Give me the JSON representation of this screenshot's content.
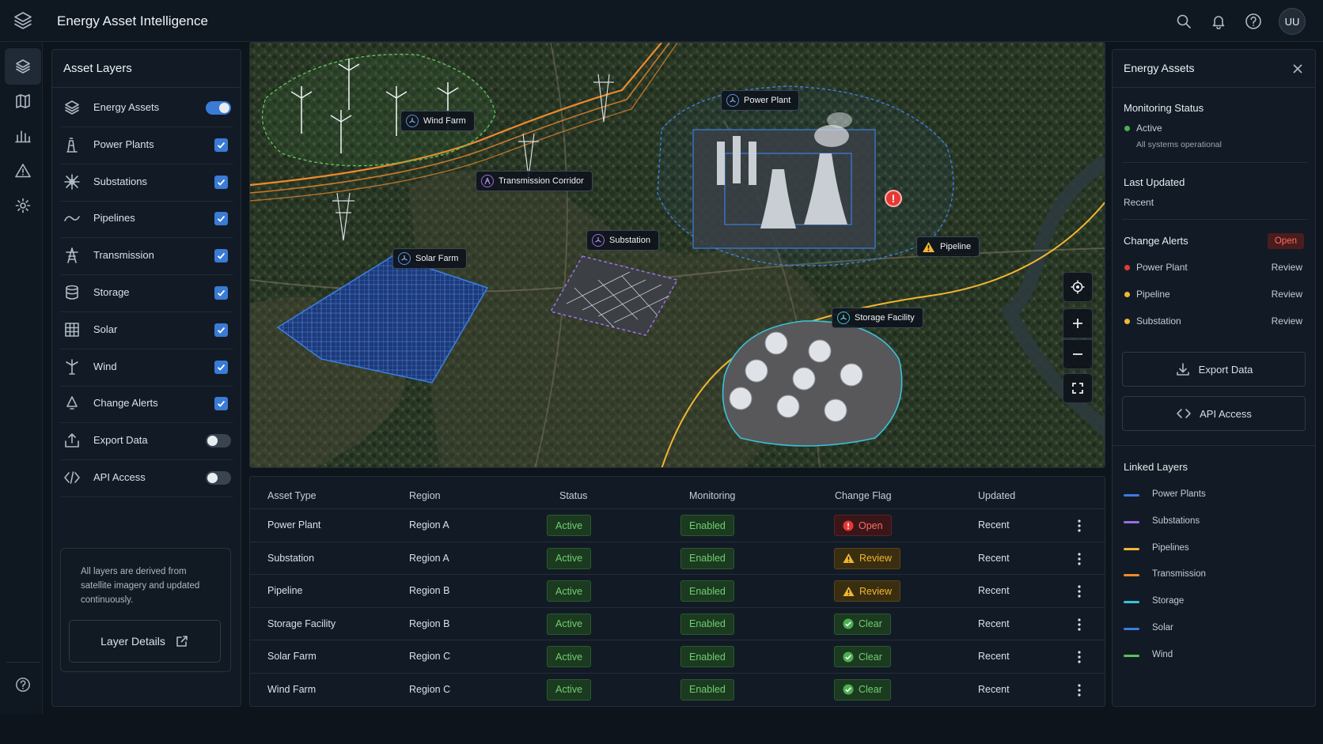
{
  "app": {
    "title": "Energy Asset Intelligence",
    "user_initials": "UU"
  },
  "layers_panel": {
    "title": "Asset Layers",
    "items": [
      {
        "label": "Energy Assets",
        "control": "toggle",
        "on": true,
        "icon": "layers-icon"
      },
      {
        "label": "Power Plants",
        "control": "checkbox",
        "on": true,
        "icon": "power-plant-icon"
      },
      {
        "label": "Substations",
        "control": "checkbox",
        "on": true,
        "icon": "substation-icon"
      },
      {
        "label": "Pipelines",
        "control": "checkbox",
        "on": true,
        "icon": "pipeline-icon"
      },
      {
        "label": "Transmission",
        "control": "checkbox",
        "on": true,
        "icon": "transmission-tower-icon"
      },
      {
        "label": "Storage",
        "control": "checkbox",
        "on": true,
        "icon": "storage-icon"
      },
      {
        "label": "Solar",
        "control": "checkbox",
        "on": true,
        "icon": "solar-panel-icon"
      },
      {
        "label": "Wind",
        "control": "checkbox",
        "on": true,
        "icon": "wind-turbine-icon"
      },
      {
        "label": "Change Alerts",
        "control": "checkbox",
        "on": true,
        "icon": "alert-bell-icon"
      },
      {
        "label": "Export Data",
        "control": "toggle",
        "on": false,
        "icon": "export-icon"
      },
      {
        "label": "API Access",
        "control": "toggle",
        "on": false,
        "icon": "code-icon"
      }
    ],
    "info_text": "All layers are derived from satellite imagery and updated continuously.",
    "details_button": "Layer Details"
  },
  "map": {
    "labels": {
      "wind_farm": "Wind Farm",
      "transmission": "Transmission Corridor",
      "power_plant": "Power Plant",
      "substation": "Substation",
      "solar_farm": "Solar Farm",
      "pipeline": "Pipeline",
      "storage": "Storage Facility"
    }
  },
  "table": {
    "headers": [
      "Asset Type",
      "Region",
      "Status",
      "Monitoring",
      "Change Flag",
      "Updated"
    ],
    "rows": [
      {
        "asset": "Power Plant",
        "region": "Region A",
        "status": "Active",
        "monitoring": "Enabled",
        "flag": "Open",
        "flag_kind": "red",
        "updated": "Recent"
      },
      {
        "asset": "Substation",
        "region": "Region A",
        "status": "Active",
        "monitoring": "Enabled",
        "flag": "Review",
        "flag_kind": "amber",
        "updated": "Recent"
      },
      {
        "asset": "Pipeline",
        "region": "Region B",
        "status": "Active",
        "monitoring": "Enabled",
        "flag": "Review",
        "flag_kind": "amber",
        "updated": "Recent"
      },
      {
        "asset": "Storage Facility",
        "region": "Region B",
        "status": "Active",
        "monitoring": "Enabled",
        "flag": "Clear",
        "flag_kind": "clear",
        "updated": "Recent"
      },
      {
        "asset": "Solar Farm",
        "region": "Region C",
        "status": "Active",
        "monitoring": "Enabled",
        "flag": "Clear",
        "flag_kind": "clear",
        "updated": "Recent"
      },
      {
        "asset": "Wind Farm",
        "region": "Region C",
        "status": "Active",
        "monitoring": "Enabled",
        "flag": "Clear",
        "flag_kind": "clear",
        "updated": "Recent"
      }
    ]
  },
  "right_panel": {
    "title": "Energy Assets",
    "monitoring_title": "Monitoring Status",
    "monitoring_value": "Active",
    "monitoring_sub": "All systems operational",
    "last_updated_title": "Last Updated",
    "last_updated_value": "Recent",
    "alerts_title": "Change Alerts",
    "alerts_badge": "Open",
    "alerts": [
      {
        "label": "Power Plant",
        "action": "Review",
        "color": "#e53935"
      },
      {
        "label": "Pipeline",
        "action": "Review",
        "color": "#f2b632"
      },
      {
        "label": "Substation",
        "action": "Review",
        "color": "#f2b632"
      }
    ],
    "export_button": "Export Data",
    "api_button": "API Access",
    "linked_title": "Linked Layers",
    "linked": [
      {
        "label": "Power Plants",
        "color": "#3b7ddd"
      },
      {
        "label": "Substations",
        "color": "#9b6ddf"
      },
      {
        "label": "Pipelines",
        "color": "#f2b632"
      },
      {
        "label": "Transmission",
        "color": "#f08a2c"
      },
      {
        "label": "Storage",
        "color": "#39c2d7"
      },
      {
        "label": "Solar",
        "color": "#3b7ddd"
      },
      {
        "label": "Wind",
        "color": "#5cc05c"
      }
    ]
  }
}
